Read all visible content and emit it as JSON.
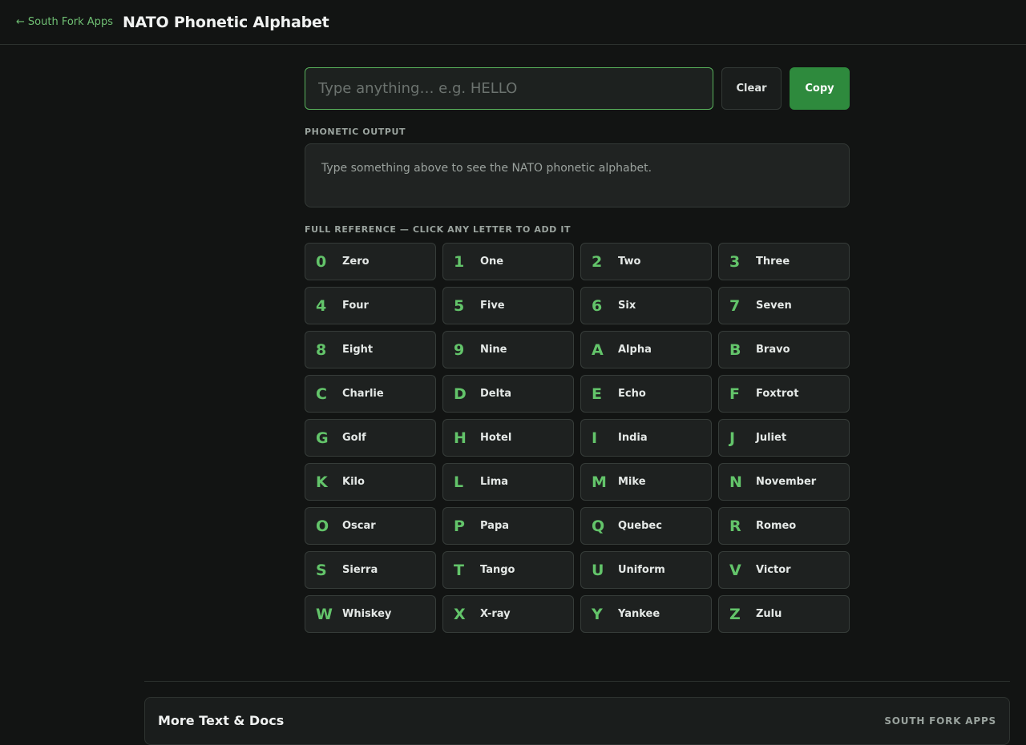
{
  "header": {
    "back_arrow": "←",
    "back_label": "South Fork Apps",
    "title": "NATO Phonetic Alphabet"
  },
  "input": {
    "value": "",
    "placeholder": "Type anything… e.g. HELLO"
  },
  "buttons": {
    "clear_label": "Clear",
    "copy_label": "Copy"
  },
  "output": {
    "label": "PHONETIC OUTPUT",
    "placeholder_text": "Type something above to see the NATO phonetic alphabet."
  },
  "reference": {
    "label": "FULL REFERENCE — CLICK ANY LETTER TO ADD IT",
    "keys": [
      {
        "char": "0",
        "word": "Zero"
      },
      {
        "char": "1",
        "word": "One"
      },
      {
        "char": "2",
        "word": "Two"
      },
      {
        "char": "3",
        "word": "Three"
      },
      {
        "char": "4",
        "word": "Four"
      },
      {
        "char": "5",
        "word": "Five"
      },
      {
        "char": "6",
        "word": "Six"
      },
      {
        "char": "7",
        "word": "Seven"
      },
      {
        "char": "8",
        "word": "Eight"
      },
      {
        "char": "9",
        "word": "Nine"
      },
      {
        "char": "A",
        "word": "Alpha"
      },
      {
        "char": "B",
        "word": "Bravo"
      },
      {
        "char": "C",
        "word": "Charlie"
      },
      {
        "char": "D",
        "word": "Delta"
      },
      {
        "char": "E",
        "word": "Echo"
      },
      {
        "char": "F",
        "word": "Foxtrot"
      },
      {
        "char": "G",
        "word": "Golf"
      },
      {
        "char": "H",
        "word": "Hotel"
      },
      {
        "char": "I",
        "word": "India"
      },
      {
        "char": "J",
        "word": "Juliet"
      },
      {
        "char": "K",
        "word": "Kilo"
      },
      {
        "char": "L",
        "word": "Lima"
      },
      {
        "char": "M",
        "word": "Mike"
      },
      {
        "char": "N",
        "word": "November"
      },
      {
        "char": "O",
        "word": "Oscar"
      },
      {
        "char": "P",
        "word": "Papa"
      },
      {
        "char": "Q",
        "word": "Quebec"
      },
      {
        "char": "R",
        "word": "Romeo"
      },
      {
        "char": "S",
        "word": "Sierra"
      },
      {
        "char": "T",
        "word": "Tango"
      },
      {
        "char": "U",
        "word": "Uniform"
      },
      {
        "char": "V",
        "word": "Victor"
      },
      {
        "char": "W",
        "word": "Whiskey"
      },
      {
        "char": "X",
        "word": "X-ray"
      },
      {
        "char": "Y",
        "word": "Yankee"
      },
      {
        "char": "Z",
        "word": "Zulu"
      }
    ]
  },
  "footer": {
    "title": "More Text & Docs",
    "brand": "SOUTH FORK APPS"
  },
  "colors": {
    "accent": "#63c46a",
    "copy_button": "#2e8a3d",
    "background": "#121413"
  }
}
